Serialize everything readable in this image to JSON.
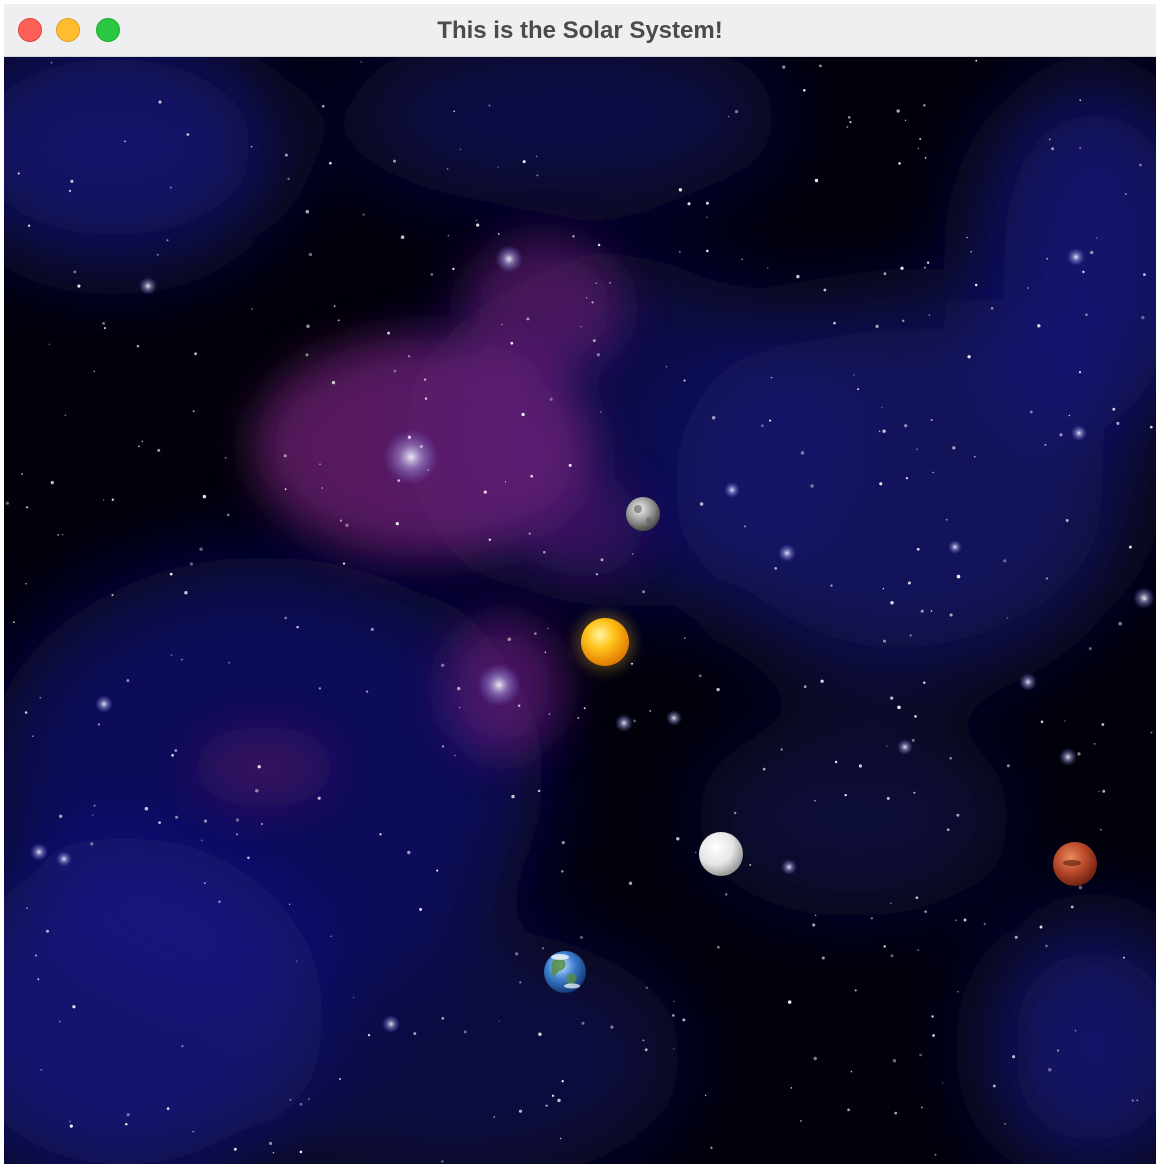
{
  "window": {
    "title": "This is the Solar System!",
    "controls": {
      "close": "close-button",
      "minimize": "minimize-button",
      "zoom": "zoom-button"
    }
  },
  "scene": {
    "background": "space-nebula",
    "colors": {
      "space": "#02020a",
      "nebula_blue": "#1a1a8c",
      "nebula_purple": "#7a2480",
      "sun": "#ffb300",
      "mars": "#c0502a",
      "earth": "#2f6fc0",
      "moon": "#d8d8d8"
    },
    "bodies": [
      "sun",
      "mercury",
      "venus",
      "earth",
      "mars"
    ]
  }
}
